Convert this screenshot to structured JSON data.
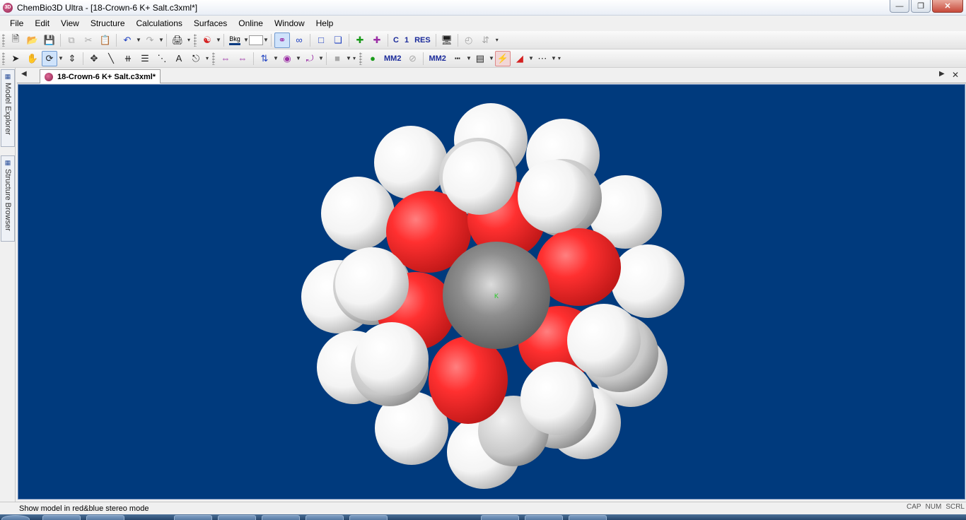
{
  "window": {
    "title": "ChemBio3D Ultra - [18-Crown-6 K+ Salt.c3xml*]",
    "app_icon": "3D"
  },
  "menu": [
    "File",
    "Edit",
    "View",
    "Structure",
    "Calculations",
    "Surfaces",
    "Online",
    "Window",
    "Help"
  ],
  "toolbar": {
    "bkg_label": "Bkg",
    "mm2_label": "MM2",
    "res_label": "RES",
    "c_label": "C",
    "one_label": "1",
    "a_label": "A"
  },
  "sidebar": {
    "model_explorer": "Model Explorer",
    "structure_browser": "Structure Browser"
  },
  "doc_tab": {
    "label": "18-Crown-6 K+ Salt.c3xml*"
  },
  "model": {
    "atom_label": "K",
    "colors": {
      "background": "#003a7d",
      "oxygen": "#ff2b2b",
      "hydrogen": "#ffffff",
      "potassium": "#8c8c8c"
    }
  },
  "status": {
    "message": "Show model in red&blue stereo mode",
    "cap": "CAP",
    "num": "NUM",
    "scrl": "SCRL"
  }
}
